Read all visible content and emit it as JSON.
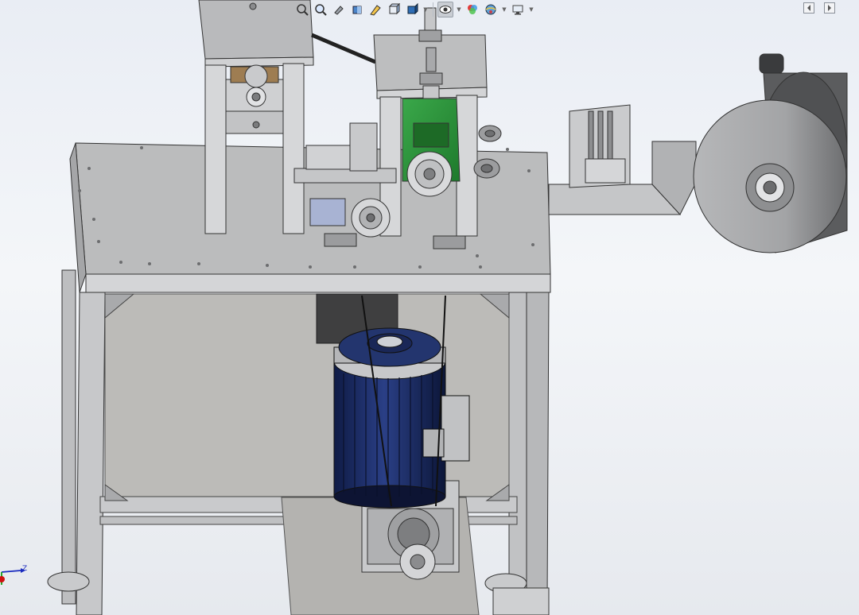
{
  "toolbar": {
    "buttons": [
      {
        "icon": "zoom-to-fit-icon"
      },
      {
        "icon": "zoom-to-area-icon"
      },
      {
        "icon": "previous-view-icon"
      },
      {
        "icon": "section-view-icon"
      },
      {
        "icon": "dynamic-annotation-icon"
      },
      {
        "icon": "view-orientation-icon"
      },
      {
        "icon": "display-style-icon"
      },
      {
        "icon": "hide-show-items-icon"
      },
      {
        "icon": "edit-appearance-icon"
      },
      {
        "icon": "apply-scene-icon"
      },
      {
        "icon": "view-settings-icon"
      }
    ]
  },
  "pane_controls": {
    "collapse_icon": "collapse-pane-icon",
    "expand_icon": "expand-pane-icon"
  },
  "triad": {
    "axis_label": "Z",
    "x_color": "#d01010",
    "y_color": "#14a014",
    "z_color": "#1a2bbf"
  },
  "model_colors": {
    "frame": "#c4c5c7",
    "motor": "#1b2d6b",
    "bracket": "#2e9a3a",
    "spool": "#a9aaac"
  }
}
